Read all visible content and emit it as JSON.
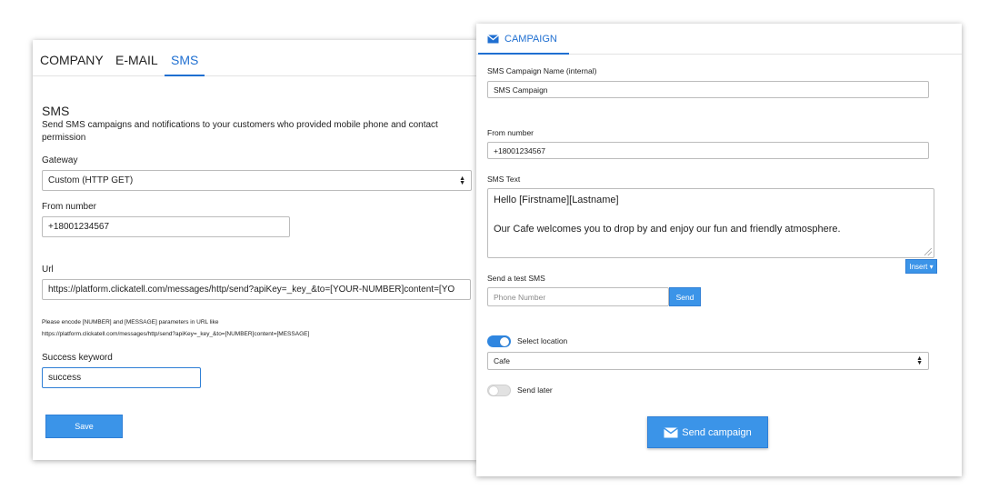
{
  "left_panel": {
    "tabs": [
      {
        "label": "COMPANY"
      },
      {
        "label": "E-MAIL"
      },
      {
        "label": "SMS"
      }
    ],
    "active_tab": "SMS",
    "section_title": "SMS",
    "description_line1": "Send SMS campaigns and notifications to your customers who provided mobile phone and contact",
    "description_line2": "permission",
    "gateway_label": "Gateway",
    "gateway_value": "Custom (HTTP GET)",
    "from_number_label": "From number",
    "from_number_value": "+18001234567",
    "url_label": "Url",
    "url_value": "https://platform.clickatell.com/messages/http/send?apiKey=_key_&to=[YOUR-NUMBER]content=[YO",
    "hint_line1": "Please encode [NUMBER] and [MESSAGE] parameters in URL like",
    "hint_line2": "https://platform.clickatell.com/messages/http/send?apiKey=_key_&to=[NUMBER]content=[MESSAGE]",
    "success_label": "Success keyword",
    "success_value": "success",
    "save_label": "Save"
  },
  "right_panel": {
    "tab_label": "CAMPAIGN",
    "tab_icon": "envelope-icon",
    "campaign_name_label": "SMS Campaign Name (internal)",
    "campaign_name_value": "SMS Campaign",
    "from_number_label": "From number",
    "from_number_value": "+18001234567",
    "sms_text_label": "SMS Text",
    "sms_text_line1": "Hello [Firstname][Lastname]",
    "sms_text_line2": "Our Cafe welcomes you to drop by and enjoy our fun and friendly atmosphere.",
    "insert_label": "Insert ▾",
    "test_sms_label": "Send a test SMS",
    "phone_placeholder": "Phone Number",
    "send_label": "Send",
    "select_location_label": "Select location",
    "select_location_on": true,
    "location_value": "Cafe",
    "send_later_label": "Send later",
    "send_later_on": false,
    "send_campaign_label": "Send campaign"
  },
  "colors": {
    "accent": "#1f6fd1",
    "button": "#3b94e8"
  }
}
